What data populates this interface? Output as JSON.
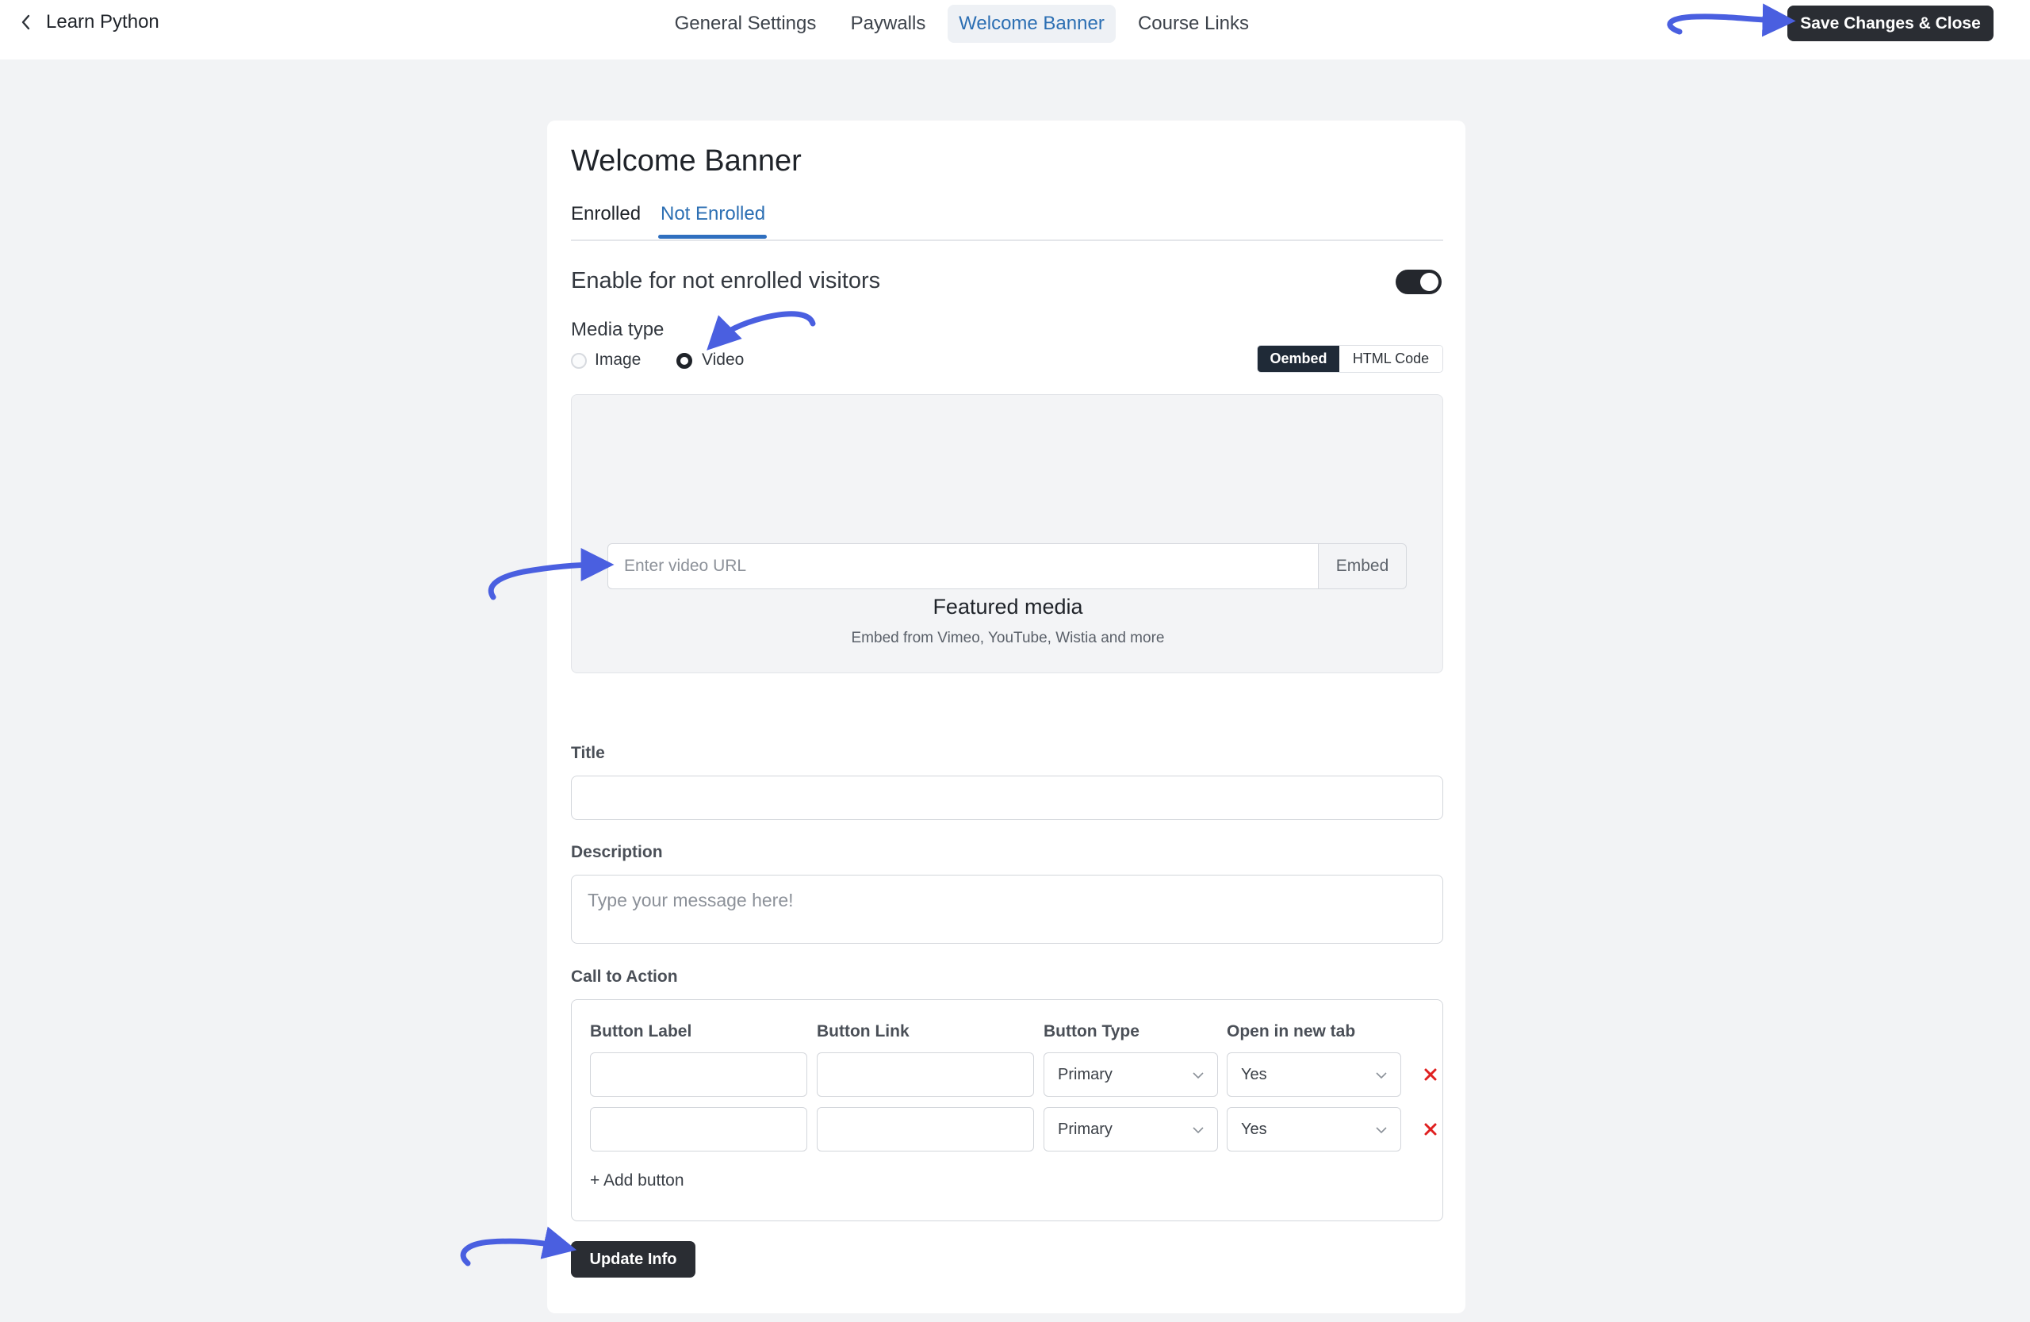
{
  "header": {
    "back_label": "Learn Python",
    "tabs": [
      {
        "label": "General Settings"
      },
      {
        "label": "Paywalls"
      },
      {
        "label": "Welcome Banner"
      },
      {
        "label": "Course Links"
      }
    ],
    "active_tab": "Welcome Banner",
    "save_label": "Save Changes & Close"
  },
  "card": {
    "title": "Welcome Banner",
    "subtabs": [
      {
        "label": "Enrolled"
      },
      {
        "label": "Not Enrolled"
      }
    ],
    "active_subtab": "Not Enrolled",
    "enable_label": "Enable for not enrolled visitors",
    "enable_toggle_on": true,
    "media_type_label": "Media type",
    "media_options": [
      {
        "label": "Image",
        "selected": false
      },
      {
        "label": "Video",
        "selected": true
      }
    ],
    "embed_modes": [
      {
        "label": "Oembed",
        "active": true
      },
      {
        "label": "HTML Code",
        "active": false
      }
    ],
    "featured": {
      "title": "Featured media",
      "subtitle": "Embed from Vimeo, YouTube, Wistia and more",
      "url_placeholder": "Enter video URL",
      "url_value": "",
      "embed_label": "Embed"
    },
    "title_label": "Title",
    "title_value": "",
    "description_label": "Description",
    "description_placeholder": "Type your message here!",
    "cta": {
      "label": "Call to Action",
      "columns": [
        "Button Label",
        "Button Link",
        "Button Type",
        "Open in new tab"
      ],
      "rows": [
        {
          "label": "",
          "link": "",
          "type": "Primary",
          "new_tab": "Yes"
        },
        {
          "label": "",
          "link": "",
          "type": "Primary",
          "new_tab": "Yes"
        }
      ],
      "add_label": "+ Add button"
    },
    "update_label": "Update Info"
  },
  "colors": {
    "accent": "#2c6fb3",
    "dark_button": "#2a2d33",
    "annotation_arrow": "#4a5fe0",
    "delete_icon": "#e02020"
  }
}
